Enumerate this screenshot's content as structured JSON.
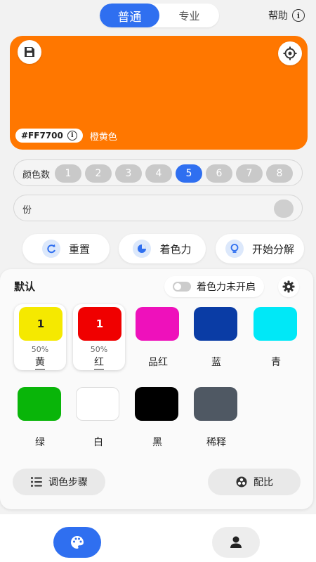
{
  "header": {
    "tabs": [
      {
        "label": "普通",
        "active": true
      },
      {
        "label": "专业",
        "active": false
      }
    ],
    "help_label": "帮助",
    "info_glyph": "i"
  },
  "color_preview": {
    "hex": "#FF7700",
    "name": "橙黄色",
    "color": "#ff7700",
    "save_icon": "save-icon",
    "target_icon": "target-icon"
  },
  "color_count": {
    "label": "颜色数",
    "options": [
      "1",
      "2",
      "3",
      "4",
      "5",
      "6",
      "7",
      "8"
    ],
    "selected": "5"
  },
  "share_row": {
    "label": "份"
  },
  "actions": {
    "reset": "重置",
    "coloring_power": "着色力",
    "start_decompose": "开始分解"
  },
  "palette": {
    "title": "默认",
    "toggle_label": "着色力未开启",
    "toggle_on": false,
    "colors": [
      {
        "name": "黄",
        "color": "#f5e900",
        "count": "1",
        "percent": "50%",
        "selected": true
      },
      {
        "name": "红",
        "color": "#f00000",
        "count": "1",
        "percent": "50%",
        "selected": true
      },
      {
        "name": "品红",
        "color": "#ee11bb",
        "selected": false
      },
      {
        "name": "蓝",
        "color": "#0a3ca5",
        "selected": false
      },
      {
        "name": "青",
        "color": "#00e8f7",
        "selected": false
      },
      {
        "name": "绿",
        "color": "#09b509",
        "selected": false
      },
      {
        "name": "白",
        "color": "#ffffff",
        "selected": false
      },
      {
        "name": "黑",
        "color": "#000000",
        "selected": false
      },
      {
        "name": "稀释",
        "color": "#4f5863",
        "selected": false
      }
    ],
    "steps_label": "调色步骤",
    "ratio_label": "配比"
  },
  "nav": {
    "palette_icon": "palette-icon",
    "user_icon": "user-icon",
    "active_color": "#2f6ff0"
  }
}
